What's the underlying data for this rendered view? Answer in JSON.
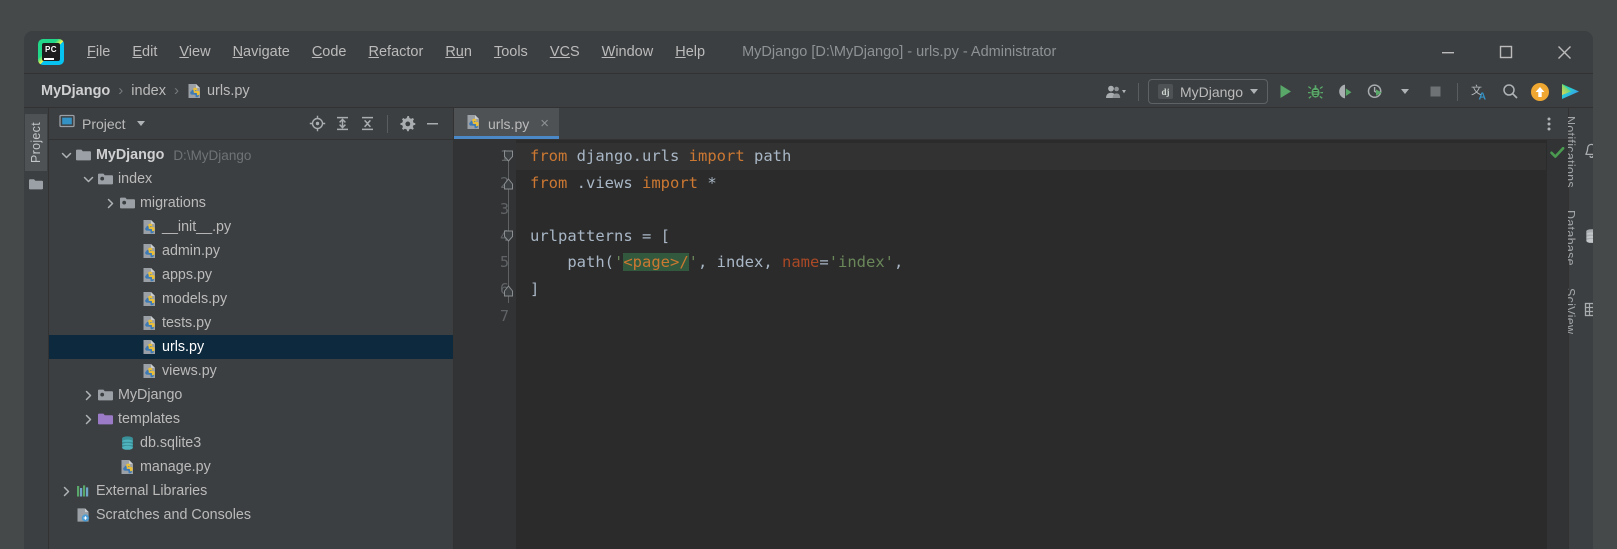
{
  "window": {
    "title": "MyDjango [D:\\MyDjango] - urls.py - Administrator",
    "logo_text": "PC",
    "controls": {
      "minimize": "minimize-icon",
      "maximize": "maximize-icon",
      "close": "close-icon"
    }
  },
  "menu": {
    "items": [
      {
        "label": "File",
        "mnemonic": "F",
        "rest": "ile"
      },
      {
        "label": "Edit",
        "mnemonic": "E",
        "rest": "dit"
      },
      {
        "label": "View",
        "mnemonic": "V",
        "rest": "iew"
      },
      {
        "label": "Navigate",
        "mnemonic": "N",
        "rest": "avigate"
      },
      {
        "label": "Code",
        "mnemonic": "C",
        "rest": "ode"
      },
      {
        "label": "Refactor",
        "mnemonic": "R",
        "rest": "efactor"
      },
      {
        "label": "Run",
        "mnemonic": "Ru",
        "rest": "n"
      },
      {
        "label": "Tools",
        "mnemonic": "T",
        "rest": "ools"
      },
      {
        "label": "VCS",
        "mnemonic": "VC",
        "rest": "S"
      },
      {
        "label": "Window",
        "mnemonic": "W",
        "rest": "indow"
      },
      {
        "label": "Help",
        "mnemonic": "H",
        "rest": "elp"
      }
    ]
  },
  "breadcrumb": {
    "items": [
      {
        "label": "MyDjango",
        "icon": null
      },
      {
        "label": "index",
        "icon": null
      },
      {
        "label": "urls.py",
        "icon": "python-file-icon"
      }
    ],
    "separator": "›"
  },
  "toolbar": {
    "user_icon": "people-icon",
    "run_config": {
      "label": "MyDjango",
      "icon_text": "dj"
    },
    "buttons": [
      {
        "name": "run-button",
        "icon": "play-icon"
      },
      {
        "name": "debug-button",
        "icon": "bug-icon"
      },
      {
        "name": "run-coverage-button",
        "icon": "coverage-icon"
      },
      {
        "name": "profile-button",
        "icon": "profiler-icon"
      },
      {
        "name": "stop-button",
        "icon": "stop-icon"
      },
      {
        "name": "translate-button",
        "icon": "translate-icon"
      },
      {
        "name": "search-everywhere-button",
        "icon": "search-icon"
      },
      {
        "name": "update-button",
        "icon": "orange-up-arrow-icon"
      },
      {
        "name": "extra-plugin-button",
        "icon": "gradient-play-icon"
      }
    ]
  },
  "left_strip": {
    "label": "Project",
    "icon": "folder-icon"
  },
  "project_panel": {
    "title": "Project",
    "actions": [
      {
        "name": "locate-file-button",
        "icon": "target-icon"
      },
      {
        "name": "expand-all-button",
        "icon": "expand-all-icon"
      },
      {
        "name": "collapse-all-button",
        "icon": "collapse-all-icon"
      },
      {
        "name": "settings-button",
        "icon": "gear-icon"
      },
      {
        "name": "hide-panel-button",
        "icon": "minimize-icon"
      }
    ],
    "tree": [
      {
        "label": "MyDjango",
        "path": "D:\\MyDjango",
        "indent": 0,
        "twisty": "down",
        "icon": "folder-icon",
        "bold": true,
        "selected": false
      },
      {
        "label": "index",
        "path": "",
        "indent": 1,
        "twisty": "down",
        "icon": "module-folder-icon",
        "bold": false,
        "selected": false
      },
      {
        "label": "migrations",
        "path": "",
        "indent": 2,
        "twisty": "right",
        "icon": "module-folder-icon",
        "bold": false,
        "selected": false
      },
      {
        "label": "__init__.py",
        "path": "",
        "indent": 3,
        "twisty": "none",
        "icon": "python-file-icon",
        "bold": false,
        "selected": false
      },
      {
        "label": "admin.py",
        "path": "",
        "indent": 3,
        "twisty": "none",
        "icon": "python-file-icon",
        "bold": false,
        "selected": false
      },
      {
        "label": "apps.py",
        "path": "",
        "indent": 3,
        "twisty": "none",
        "icon": "python-file-icon",
        "bold": false,
        "selected": false
      },
      {
        "label": "models.py",
        "path": "",
        "indent": 3,
        "twisty": "none",
        "icon": "python-file-icon",
        "bold": false,
        "selected": false
      },
      {
        "label": "tests.py",
        "path": "",
        "indent": 3,
        "twisty": "none",
        "icon": "python-file-icon",
        "bold": false,
        "selected": false
      },
      {
        "label": "urls.py",
        "path": "",
        "indent": 3,
        "twisty": "none",
        "icon": "python-file-icon",
        "bold": false,
        "selected": true
      },
      {
        "label": "views.py",
        "path": "",
        "indent": 3,
        "twisty": "none",
        "icon": "python-file-icon",
        "bold": false,
        "selected": false
      },
      {
        "label": "MyDjango",
        "path": "",
        "indent": 1,
        "twisty": "right",
        "icon": "module-folder-icon",
        "bold": false,
        "selected": false
      },
      {
        "label": "templates",
        "path": "",
        "indent": 1,
        "twisty": "right",
        "icon": "templates-folder-icon",
        "bold": false,
        "selected": false
      },
      {
        "label": "db.sqlite3",
        "path": "",
        "indent": 2,
        "twisty": "none",
        "icon": "database-icon",
        "bold": false,
        "selected": false
      },
      {
        "label": "manage.py",
        "path": "",
        "indent": 2,
        "twisty": "none",
        "icon": "python-file-icon",
        "bold": false,
        "selected": false
      },
      {
        "label": "External Libraries",
        "path": "",
        "indent": 0,
        "twisty": "right",
        "icon": "libraries-icon",
        "bold": false,
        "selected": false
      },
      {
        "label": "Scratches and Consoles",
        "path": "",
        "indent": 0,
        "twisty": "none",
        "icon": "scratches-icon",
        "bold": false,
        "selected": false
      }
    ]
  },
  "editor": {
    "tabs": [
      {
        "label": "urls.py",
        "icon": "python-file-icon",
        "active": true,
        "close": "×"
      }
    ],
    "more_icon": "more-vertical-icon",
    "line_numbers": [
      "1",
      "2",
      "3",
      "4",
      "5",
      "6",
      "7"
    ],
    "lines": [
      {
        "n": "1",
        "current": true,
        "tokens": [
          {
            "t": "from ",
            "c": "kw"
          },
          {
            "t": "django.urls ",
            "c": "id"
          },
          {
            "t": "import ",
            "c": "kw"
          },
          {
            "t": "path",
            "c": "id"
          }
        ]
      },
      {
        "n": "2",
        "current": false,
        "tokens": [
          {
            "t": "from ",
            "c": "kw"
          },
          {
            "t": ".views ",
            "c": "id"
          },
          {
            "t": "import ",
            "c": "kw"
          },
          {
            "t": "*",
            "c": "id"
          }
        ]
      },
      {
        "n": "3",
        "current": false,
        "tokens": []
      },
      {
        "n": "4",
        "current": false,
        "tokens": [
          {
            "t": "urlpatterns = [",
            "c": "id"
          }
        ]
      },
      {
        "n": "5",
        "current": false,
        "tokens": [
          {
            "t": "    path(",
            "c": "id"
          },
          {
            "t": "'",
            "c": "str"
          },
          {
            "t": "<page>/",
            "c": "hl"
          },
          {
            "t": "'",
            "c": "str"
          },
          {
            "t": ", index, ",
            "c": "id"
          },
          {
            "t": "name",
            "c": "named"
          },
          {
            "t": "=",
            "c": "id"
          },
          {
            "t": "'index'",
            "c": "str"
          },
          {
            "t": ",",
            "c": "id"
          }
        ]
      },
      {
        "n": "6",
        "current": false,
        "tokens": [
          {
            "t": "]",
            "c": "id"
          }
        ]
      },
      {
        "n": "7",
        "current": false,
        "tokens": []
      }
    ],
    "inspection_status": "ok-check-icon"
  },
  "right_strip": {
    "tabs": [
      {
        "label": "Notifications",
        "icon": "bell-icon"
      },
      {
        "label": "Database",
        "icon": "database-icon"
      },
      {
        "label": "SciView",
        "icon": "grid-icon"
      }
    ]
  },
  "colors": {
    "accent_blue": "#4a88c7",
    "selection_navy": "#0d293e",
    "keyword_orange": "#cc7832",
    "string_green": "#6a8759",
    "highlight_green": "#32593d",
    "panel_bg": "#3c3f41",
    "editor_bg": "#2b2b2b",
    "gutter_bg": "#313335"
  }
}
